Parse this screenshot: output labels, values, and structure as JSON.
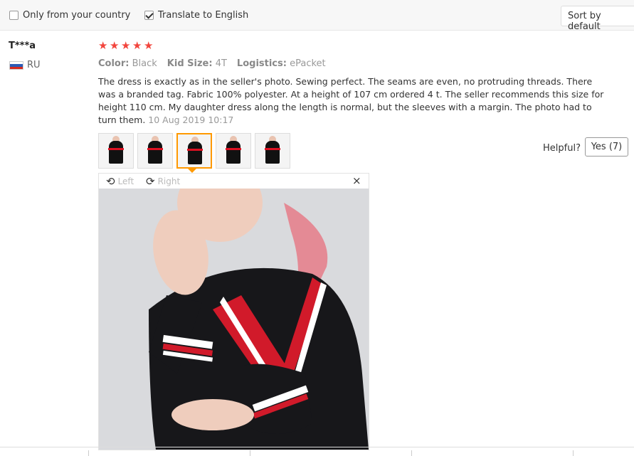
{
  "filters": {
    "country_label": "Only from your country",
    "country_checked": false,
    "translate_label": "Translate to English",
    "translate_checked": true,
    "sort_label": "Sort by default"
  },
  "review": {
    "username": "T***a",
    "country": "RU",
    "rating": 5,
    "rating_max": 5,
    "color_label": "Color:",
    "color_value": "Black",
    "size_label": "Kid Size:",
    "size_value": "4T",
    "logistics_label": "Logistics:",
    "logistics_value": "ePacket",
    "text": "The dress is exactly as in the seller's photo. Sewing perfect. The seams are even, no protruding threads. There was a branded tag. Fabric 100% polyester. At a height of 107 cm ordered 4 t. The seller recommends this size for height 110 cm. My daughter dress along the length is normal, but the sleeves with a margin. The photo had to turn them.",
    "date": "10 Aug 2019 10:17",
    "photo_count": 5,
    "active_photo_index": 2
  },
  "helpful": {
    "label": "Helpful?",
    "yes_label": "Yes (7)"
  },
  "viewer": {
    "rotate_left": "Left",
    "rotate_right": "Right",
    "close": "×"
  },
  "colors": {
    "star": "#f2453d",
    "active_thumb": "#ff9900",
    "dress_stripe": "#d11a2a"
  }
}
